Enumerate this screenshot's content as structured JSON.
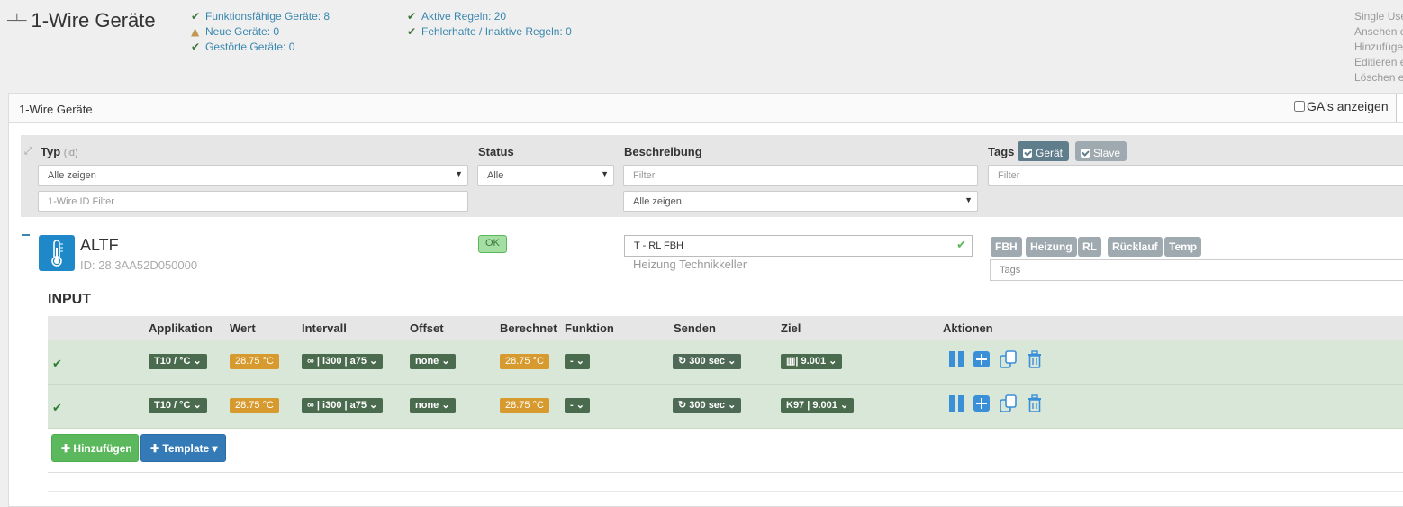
{
  "header": {
    "title": "1-Wire Geräte",
    "title_icon": "one-wire-icon",
    "stats_left": [
      {
        "icon": "check-icon",
        "text": "Funktionsfähige Geräte: 8"
      },
      {
        "icon": "warning-icon",
        "text": "Neue Geräte: 0"
      },
      {
        "icon": "check-icon",
        "text": "Gestörte Geräte: 0"
      }
    ],
    "stats_right": [
      {
        "icon": "check-icon",
        "text": "Aktive Regeln: 20"
      },
      {
        "icon": "check-icon",
        "text": "Fehlerhafte / Inaktive Regeln: 0"
      }
    ],
    "help_lines": [
      "Single Use",
      "Ansehen e",
      "Hinzufüge",
      "Editieren e",
      "Löschen e"
    ]
  },
  "panel": {
    "title": "1-Wire Geräte",
    "ga_label": "GA's anzeigen"
  },
  "filters": {
    "typ_label": "Typ",
    "typ_hint": "(id)",
    "typ_select": "Alle zeigen",
    "id_filter_placeholder": "1-Wire ID Filter",
    "status_label": "Status",
    "status_select": "Alle",
    "beschreibung_label": "Beschreibung",
    "beschreibung_placeholder": "Filter",
    "beschreibung_select": "Alle zeigen",
    "tags_label": "Tags",
    "tag_buttons": [
      "Gerät",
      "Slave"
    ],
    "tags_placeholder": "Filter"
  },
  "device": {
    "name": "ALTF",
    "id": "ID: 28.3AA52D050000",
    "status": "OK",
    "description": "T - RL FBH",
    "sub_description": "Heizung Technikkeller",
    "tags": [
      "FBH",
      "Heizung",
      "RL",
      "Rücklauf",
      "Temp"
    ],
    "tags_placeholder": "Tags"
  },
  "input_section": {
    "title": "INPUT",
    "columns": [
      "Applikation",
      "Wert",
      "Intervall",
      "Offset",
      "Berechnet",
      "Funktion",
      "Senden",
      "Ziel",
      "Aktionen"
    ],
    "rows": [
      {
        "applikation": "T10 / °C",
        "wert": "28.75 °C",
        "intervall": "∞ | i300 | a75",
        "offset": "none",
        "berechnet": "28.75 °C",
        "funktion": "-",
        "senden": "300 sec",
        "ziel": "| 9.001"
      },
      {
        "applikation": "T10 / °C",
        "wert": "28.75 °C",
        "intervall": "∞ | i300 | a75",
        "offset": "none",
        "berechnet": "28.75 °C",
        "funktion": "-",
        "senden": "300 sec",
        "ziel": "K97 | 9.001"
      }
    ],
    "add_button": "Hinzufügen",
    "template_button": "Template"
  },
  "colors": {
    "accent": "#3a87ad",
    "row_bg": "#d9e7d9",
    "badge_dark": "#4a6b4d",
    "badge_orange": "#d79a2e",
    "action_blue": "#3a8fd9"
  }
}
